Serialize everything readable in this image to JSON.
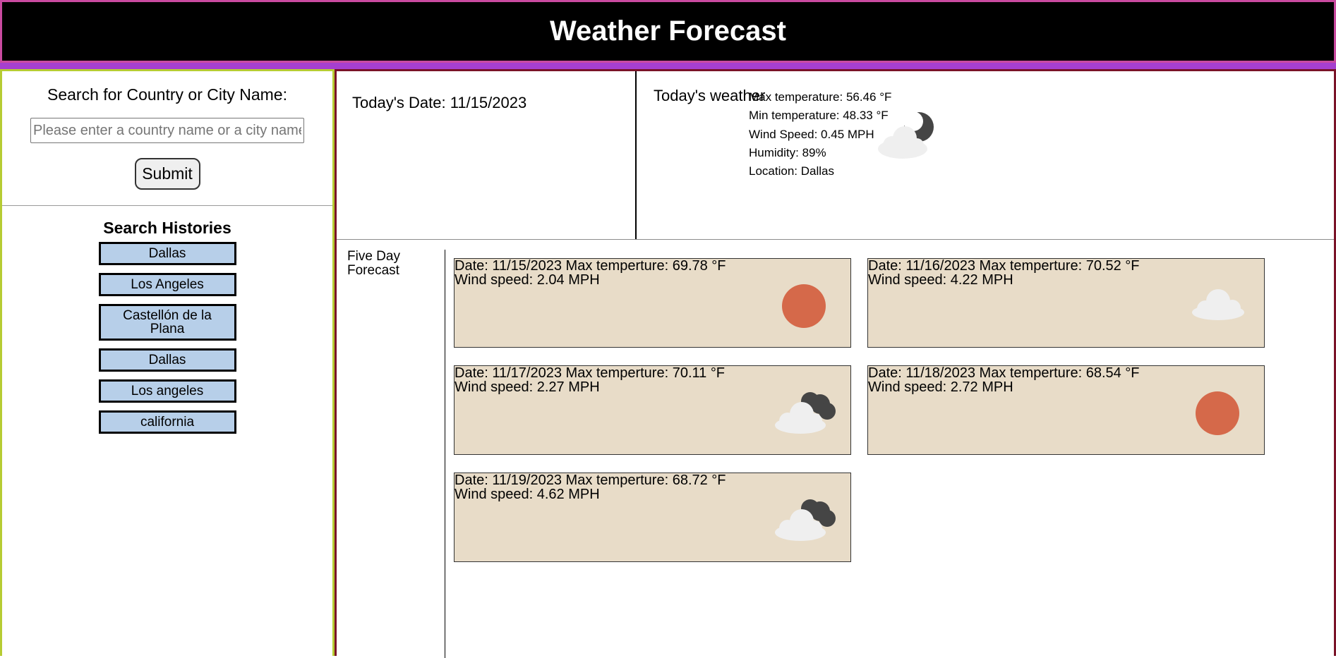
{
  "app": {
    "title": "Weather Forecast"
  },
  "sidebar": {
    "search_label": "Search for Country or City Name:",
    "search_placeholder": "Please enter a country name or a city name",
    "search_value": "",
    "submit_label": "Submit",
    "history_title": "Search Histories",
    "history": [
      "Dallas",
      "Los Angeles",
      "Castellón de la Plana",
      "Dallas",
      "Los angeles",
      "california"
    ]
  },
  "today": {
    "date_text": "Today's Date: 11/15/2023",
    "weather_label": "Today's weather",
    "max_temp": "Max temperature: 56.46 °F",
    "min_temp": "Min temperature: 48.33 °F",
    "wind": "Wind Speed: 0.45 MPH",
    "humidity": "Humidity: 89%",
    "location": "Location: Dallas",
    "icon": "partly-cloudy-night-icon"
  },
  "forecast": {
    "label": "Five Day Forecast",
    "days": [
      {
        "date_temp": "Date: 11/15/2023 Max temperture: 69.78 °F",
        "wind": "Wind speed: 2.04 MPH",
        "icon": "sun-icon"
      },
      {
        "date_temp": "Date: 11/16/2023 Max temperture: 70.52 °F",
        "wind": "Wind speed: 4.22 MPH",
        "icon": "cloud-icon"
      },
      {
        "date_temp": "Date: 11/17/2023 Max temperture: 70.11 °F",
        "wind": "Wind speed: 2.27 MPH",
        "icon": "broken-clouds-icon"
      },
      {
        "date_temp": "Date: 11/18/2023 Max temperture: 68.54 °F",
        "wind": "Wind speed: 2.72 MPH",
        "icon": "sun-icon"
      },
      {
        "date_temp": "Date: 11/19/2023 Max temperture: 68.72 °F",
        "wind": "Wind speed: 4.62 MPH",
        "icon": "broken-clouds-icon"
      }
    ]
  },
  "colors": {
    "header_bg": "#000000",
    "header_border": "#c94aa0",
    "accent_bar": "#a63fcf",
    "sidebar_border": "#b6cc33",
    "main_border": "#7a1328",
    "history_bg": "#b7cfe9",
    "card_bg": "#e8dcc8",
    "sun": "#d5694a"
  }
}
